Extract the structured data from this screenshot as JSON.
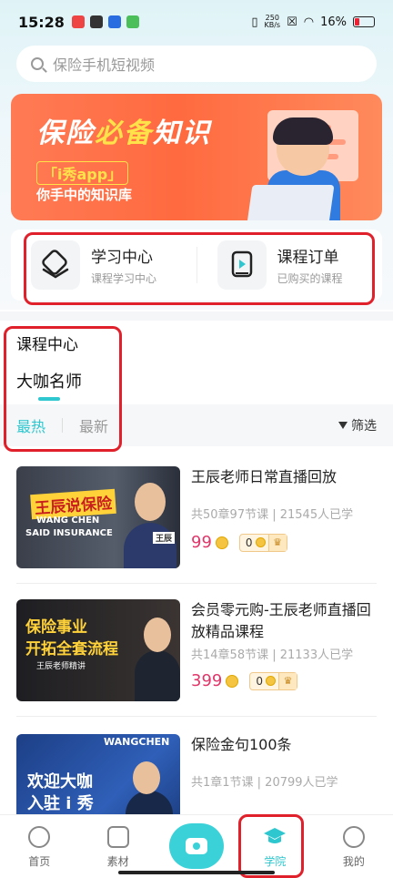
{
  "status_bar": {
    "time": "15:28",
    "speed_value": "250",
    "speed_unit": "KB/s",
    "battery": "16%"
  },
  "search": {
    "placeholder": "保险手机短视频"
  },
  "banner": {
    "title_part1": "保险",
    "title_highlight": "必备",
    "title_part2": "知识",
    "app_tag": "「i秀app」",
    "subtitle": "你手中的知识库"
  },
  "quick_entries": [
    {
      "title": "学习中心",
      "subtitle": "课程学习中心",
      "icon": "layers-icon"
    },
    {
      "title": "课程订单",
      "subtitle": "已购买的课程",
      "icon": "play-order-icon"
    }
  ],
  "course_center": {
    "title": "课程中心",
    "teacher_tab": "大咖名师",
    "sort_tabs": [
      "最热",
      "最新"
    ],
    "active_sort": "最热",
    "filter_label": "筛选"
  },
  "courses": [
    {
      "name": "王辰老师日常直播回放",
      "meta": "共50章97节课 | 21545人已学",
      "price": "99",
      "vip_price": "0",
      "thumb_line1": "王辰说保险",
      "thumb_line2": "WANG CHEN",
      "thumb_line3": "SAID INSURANCE",
      "thumb_tag": "王辰"
    },
    {
      "name": "会员零元购-王辰老师直播回放精品课程",
      "meta": "共14章58节课 | 21133人已学",
      "price": "399",
      "vip_price": "0",
      "thumb_line1": "保险事业",
      "thumb_line2": "开拓全套流程",
      "thumb_line3": "王辰老师精讲"
    },
    {
      "name": "保险金句100条",
      "meta": "共1章1节课 | 20799人已学",
      "thumb_line1": "欢迎大咖",
      "thumb_line2": "入驻 i 秀",
      "thumb_line3": "WANGCHEN"
    }
  ],
  "bottom_nav": [
    {
      "label": "首页",
      "icon": "home-icon"
    },
    {
      "label": "素材",
      "icon": "material-icon"
    },
    {
      "label": "",
      "icon": "camera-icon"
    },
    {
      "label": "学院",
      "icon": "graduation-cap-icon"
    },
    {
      "label": "我的",
      "icon": "profile-icon"
    }
  ],
  "colors": {
    "accent": "#2ec7cf",
    "price": "#e0366a",
    "annotation_red": "#e0202b"
  }
}
